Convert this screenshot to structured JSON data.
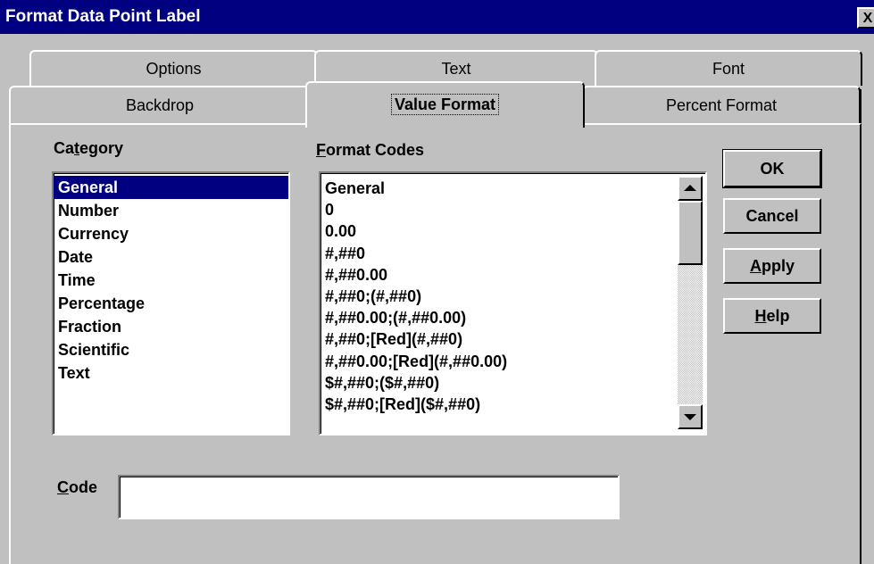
{
  "window": {
    "title": "Format Data Point Label",
    "close_glyph": "X"
  },
  "tabs": {
    "back_row": [
      {
        "label": "Options"
      },
      {
        "label": "Text"
      },
      {
        "label": "Font"
      }
    ],
    "front_row": [
      {
        "label": "Backdrop"
      },
      {
        "label": "Value Format",
        "active": true
      },
      {
        "label": "Percent Format"
      }
    ]
  },
  "category": {
    "label_pre": "Ca",
    "label_ul": "t",
    "label_post": "egory",
    "items": [
      "General",
      "Number",
      "Currency",
      "Date",
      "Time",
      "Percentage",
      "Fraction",
      "Scientific",
      "Text"
    ],
    "selected": "General"
  },
  "format_codes": {
    "label_ul": "F",
    "label_post": "ormat Codes",
    "items": [
      "General",
      "0",
      "0.00",
      "#,##0",
      "#,##0.00",
      "#,##0;(#,##0)",
      "#,##0.00;(#,##0.00)",
      "#,##0;[Red](#,##0)",
      "#,##0.00;[Red](#,##0.00)",
      "$#,##0;($#,##0)",
      "$#,##0;[Red]($#,##0)"
    ]
  },
  "buttons": {
    "ok": "OK",
    "cancel": "Cancel",
    "apply_ul": "A",
    "apply_post": "pply",
    "help_ul": "H",
    "help_post": "elp"
  },
  "code": {
    "label_ul": "C",
    "label_post": "ode",
    "value": ""
  },
  "colors": {
    "titlebar": "#000080",
    "face": "#c0c0c0",
    "selection": "#000080"
  },
  "icons": {
    "close": "close-icon",
    "scroll_up": "arrow-up-icon",
    "scroll_down": "arrow-down-icon"
  }
}
